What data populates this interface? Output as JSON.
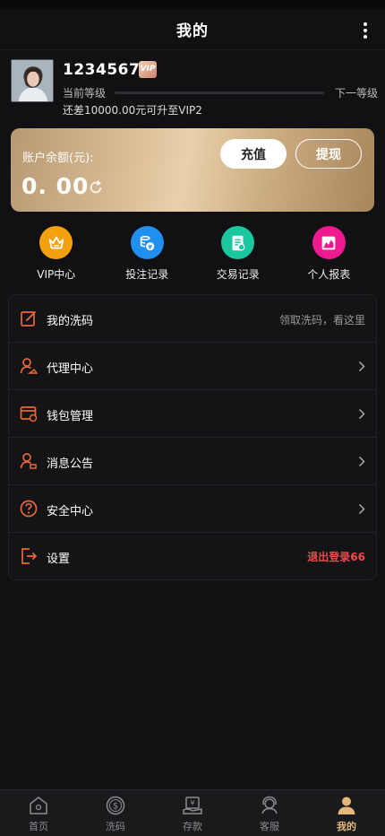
{
  "header": {
    "title": "我的"
  },
  "profile": {
    "username": "12345678",
    "vip_badge": "VIP",
    "level_current_label": "当前等级",
    "level_next_label": "下一等级",
    "level_progress": 0.0,
    "upgrade_hint": "还差10000.00元可升至VIP2"
  },
  "balance": {
    "label": "账户余额(元):",
    "value": "0. 00",
    "recharge_label": "充值",
    "withdraw_label": "提现"
  },
  "quick_menu": [
    {
      "label": "VIP中心",
      "icon": "crown-icon",
      "color": "#f4a10f"
    },
    {
      "label": "投注记录",
      "icon": "coins-icon",
      "color": "#1f8ff0"
    },
    {
      "label": "交易记录",
      "icon": "receipt-icon",
      "color": "#1ac7a0"
    },
    {
      "label": "个人报表",
      "icon": "chart-icon",
      "color": "#ee1a8e"
    }
  ],
  "menu": [
    {
      "label": "我的洗码",
      "icon": "edit-icon",
      "right_text": "领取洗码，看这里"
    },
    {
      "label": "代理中心",
      "icon": "user-agent-icon"
    },
    {
      "label": "钱包管理",
      "icon": "wallet-icon"
    },
    {
      "label": "消息公告",
      "icon": "user-message-icon"
    },
    {
      "label": "安全中心",
      "icon": "question-icon"
    },
    {
      "label": "设置",
      "icon": "logout-icon",
      "right_text": "退出登录66"
    }
  ],
  "accent_color": "#e8673a",
  "tabs": [
    {
      "label": "首页",
      "icon": "home-icon"
    },
    {
      "label": "洗码",
      "icon": "dollar-circle-icon"
    },
    {
      "label": "存款",
      "icon": "deposit-icon"
    },
    {
      "label": "客服",
      "icon": "customer-service-icon"
    },
    {
      "label": "我的",
      "icon": "profile-icon",
      "active": true
    }
  ]
}
